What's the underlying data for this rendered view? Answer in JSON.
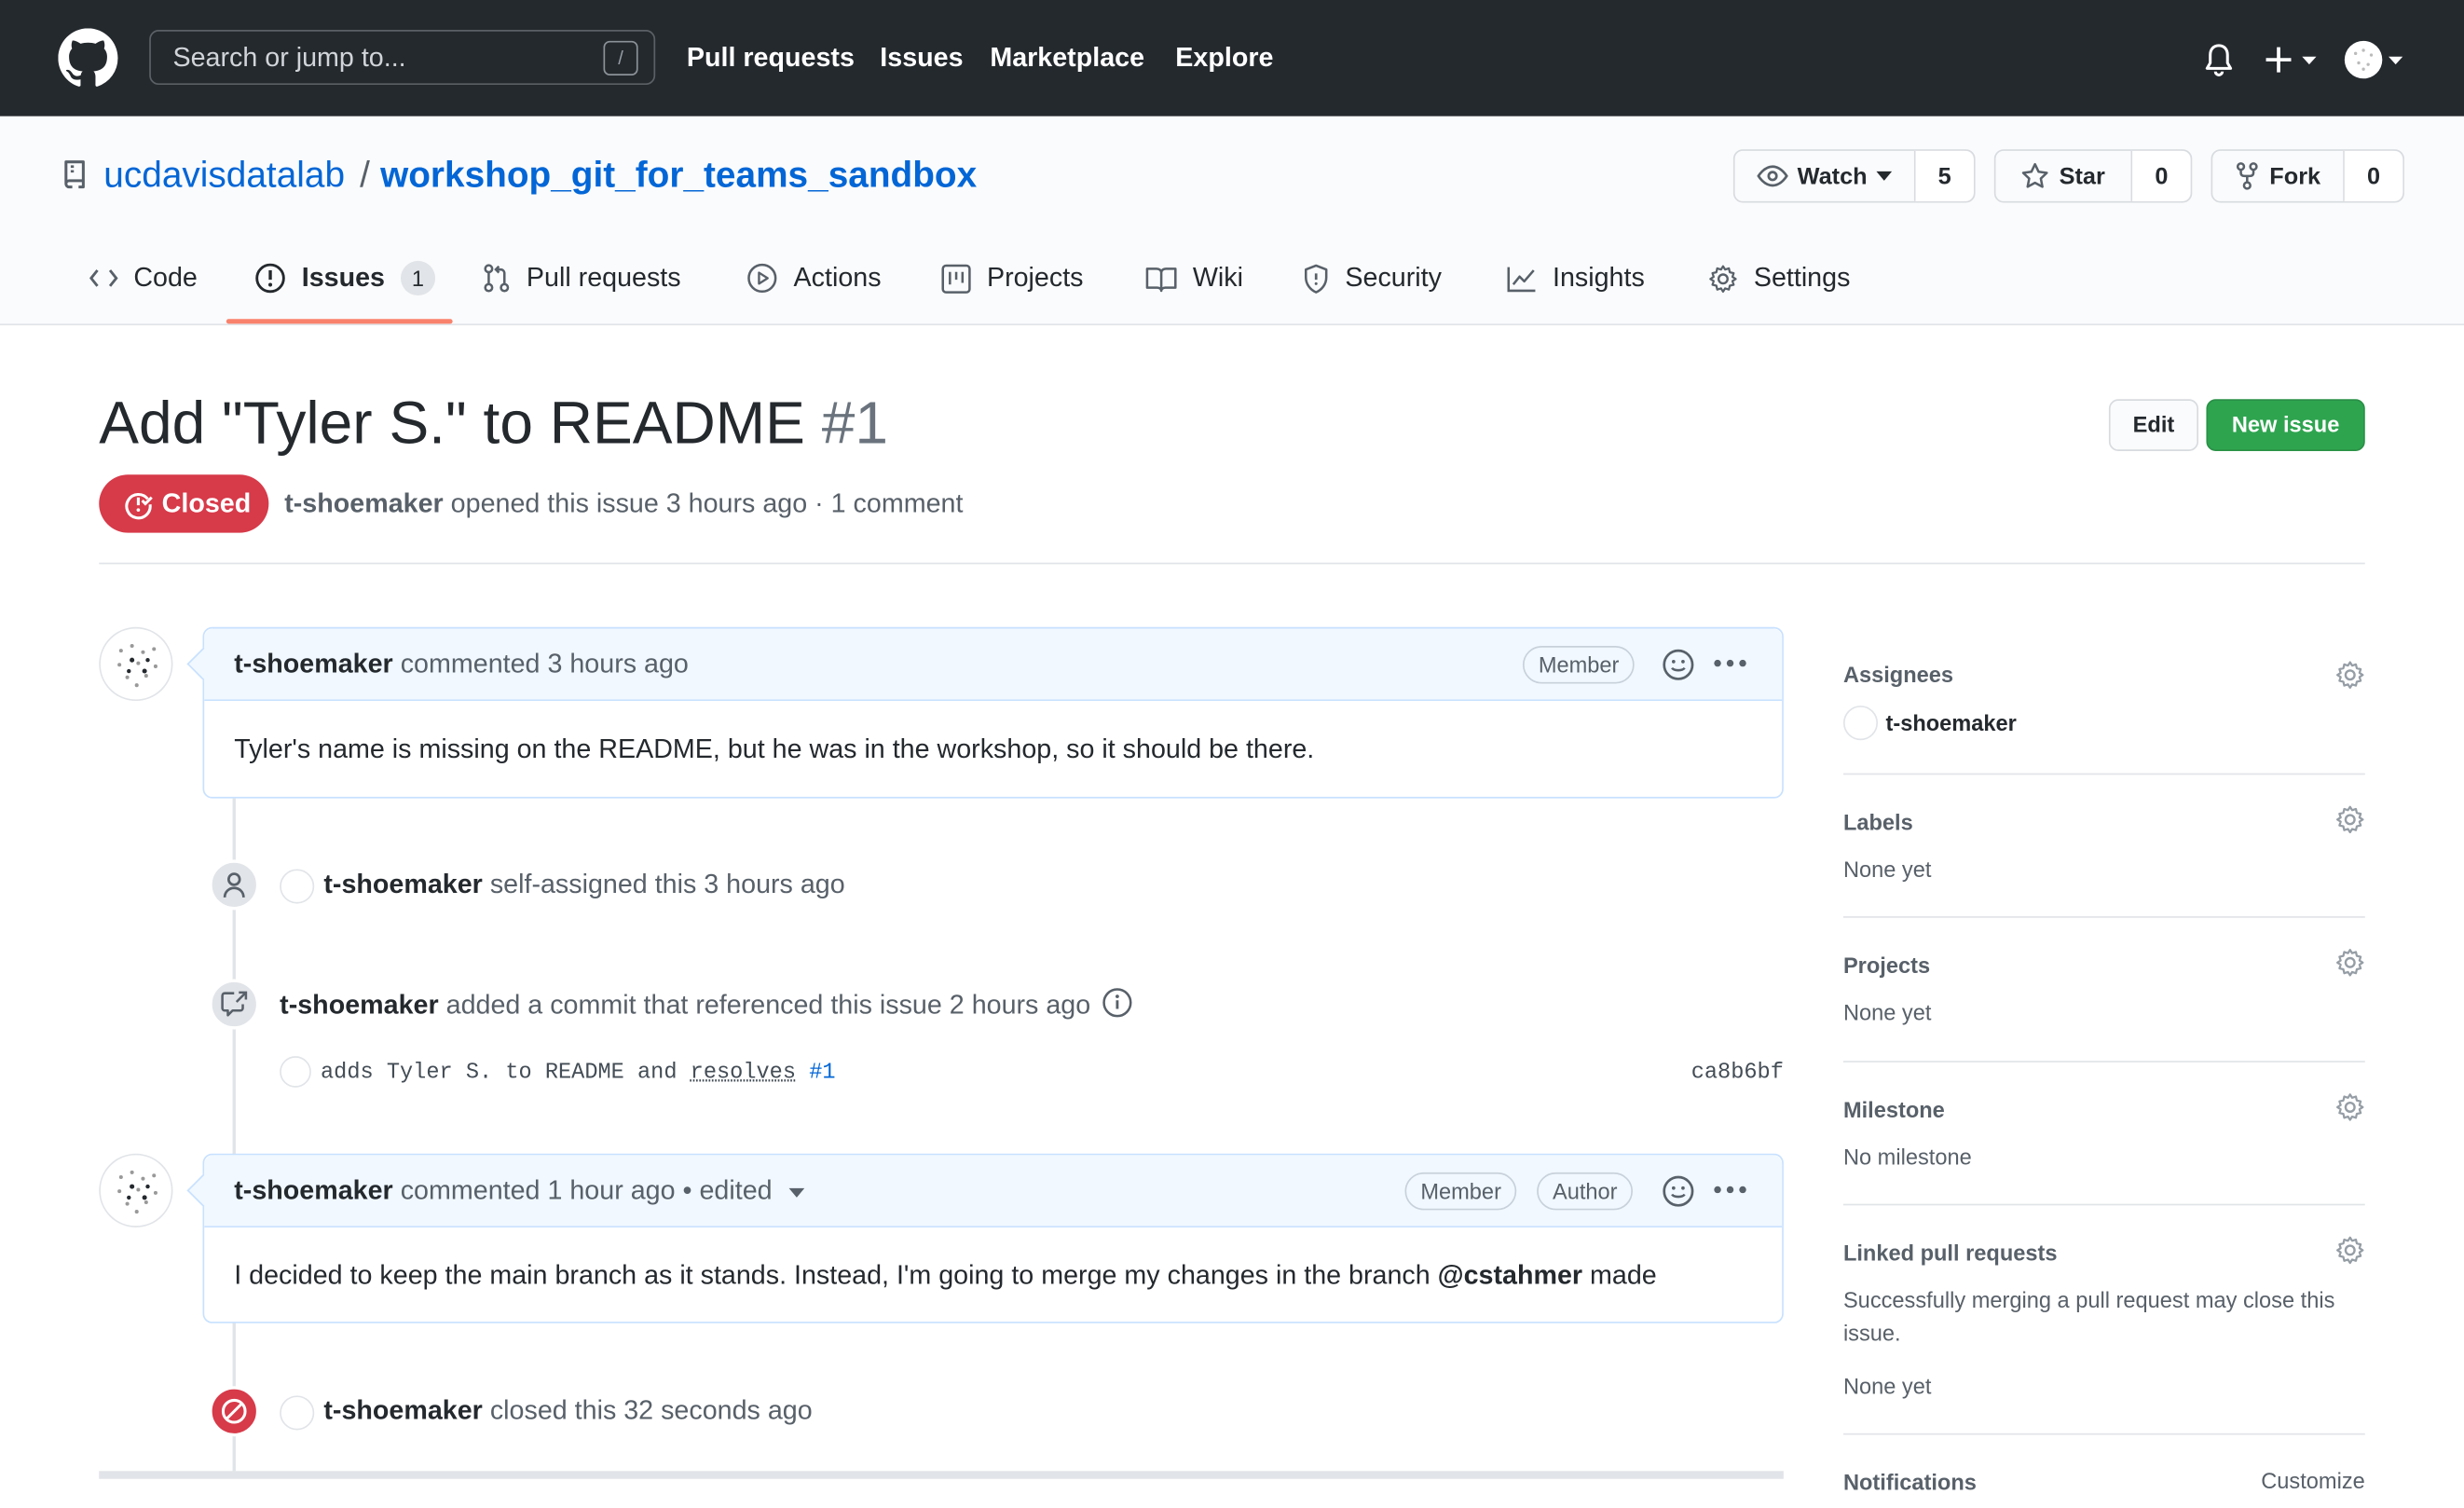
{
  "header": {
    "search_placeholder": "Search or jump to...",
    "search_shortcut": "/",
    "nav": [
      "Pull requests",
      "Issues",
      "Marketplace",
      "Explore"
    ]
  },
  "repo": {
    "owner": "ucdavisdatalab",
    "separator": "/",
    "name": "workshop_git_for_teams_sandbox",
    "watch_label": "Watch",
    "watch_count": "5",
    "star_label": "Star",
    "star_count": "0",
    "fork_label": "Fork",
    "fork_count": "0"
  },
  "tabs": {
    "code": "Code",
    "issues": "Issues",
    "issues_count": "1",
    "pulls": "Pull requests",
    "actions": "Actions",
    "projects": "Projects",
    "wiki": "Wiki",
    "security": "Security",
    "insights": "Insights",
    "settings": "Settings"
  },
  "issue": {
    "title": "Add \"Tyler S.\" to README",
    "number": "#1",
    "edit_label": "Edit",
    "new_issue_label": "New issue",
    "state": "Closed",
    "author": "t-shoemaker",
    "meta_rest": "opened this issue 3 hours ago · 1 comment"
  },
  "comments": [
    {
      "author": "t-shoemaker",
      "action": "commented 3 hours ago",
      "badges": [
        "Member"
      ],
      "body": "Tyler's name is missing on the README, but he was in the workshop, so it should be there."
    },
    {
      "author": "t-shoemaker",
      "action": "commented 1 hour ago • edited",
      "badges": [
        "Member",
        "Author"
      ],
      "body_pre": "I decided to keep the main branch as it stands. Instead, I'm going to merge my changes in the branch ",
      "mention": "@cstahmer",
      "body_post": " made"
    }
  ],
  "events": {
    "assign_actor": "t-shoemaker",
    "assign_text": "self-assigned this 3 hours ago",
    "commit_actor": "t-shoemaker",
    "commit_text": "added a commit that referenced this issue 2 hours ago",
    "commit_msg_pre": "adds Tyler S. to README and ",
    "commit_msg_kw": "resolves",
    "commit_msg_ref": "#1",
    "commit_sha": "ca8b6bf",
    "close_actor": "t-shoemaker",
    "close_text": "closed this 32 seconds ago"
  },
  "sidebar": {
    "assignees_label": "Assignees",
    "assignee": "t-shoemaker",
    "labels_label": "Labels",
    "labels_value": "None yet",
    "projects_label": "Projects",
    "projects_value": "None yet",
    "milestone_label": "Milestone",
    "milestone_value": "No milestone",
    "linked_label": "Linked pull requests",
    "linked_desc": "Successfully merging a pull request may close this issue.",
    "linked_value": "None yet",
    "notifications_label": "Notifications",
    "customize_label": "Customize"
  },
  "colors": {
    "header_bg": "#24292e",
    "link": "#0366d6",
    "closed": "#d73a49",
    "new_issue": "#2ea44f",
    "tab_underline": "#f9826c"
  }
}
